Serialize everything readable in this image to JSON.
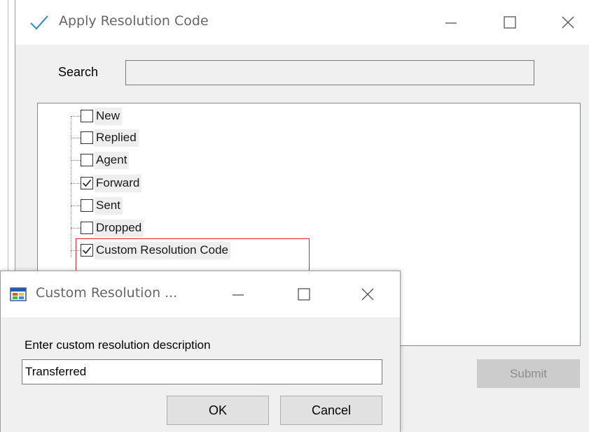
{
  "main_window": {
    "title": "Apply Resolution Code",
    "title_icon": "checkmark-icon",
    "controls": [
      "minimize-icon",
      "maximize-icon",
      "close-icon"
    ],
    "search": {
      "label": "Search",
      "value": ""
    },
    "tree": {
      "items": [
        {
          "label": "New",
          "checked": false
        },
        {
          "label": "Replied",
          "checked": false
        },
        {
          "label": "Agent",
          "checked": false
        },
        {
          "label": "Forward",
          "checked": true
        },
        {
          "label": "Sent",
          "checked": false
        },
        {
          "label": "Dropped",
          "checked": false
        },
        {
          "label": "Custom Resolution Code",
          "checked": true
        }
      ]
    },
    "submit_label": "Submit",
    "submit_enabled": false
  },
  "dialog": {
    "title": "Custom Resolution ...",
    "title_icon": "form-app-icon",
    "controls": [
      "minimize-icon",
      "maximize-icon",
      "close-icon"
    ],
    "prompt": "Enter custom resolution description",
    "input_value": "Transferred",
    "ok_label": "OK",
    "cancel_label": "Cancel"
  },
  "colors": {
    "accent_check": "#3c8fd8",
    "highlight": "#e1252c",
    "window_bg": "#f0f0f0"
  }
}
